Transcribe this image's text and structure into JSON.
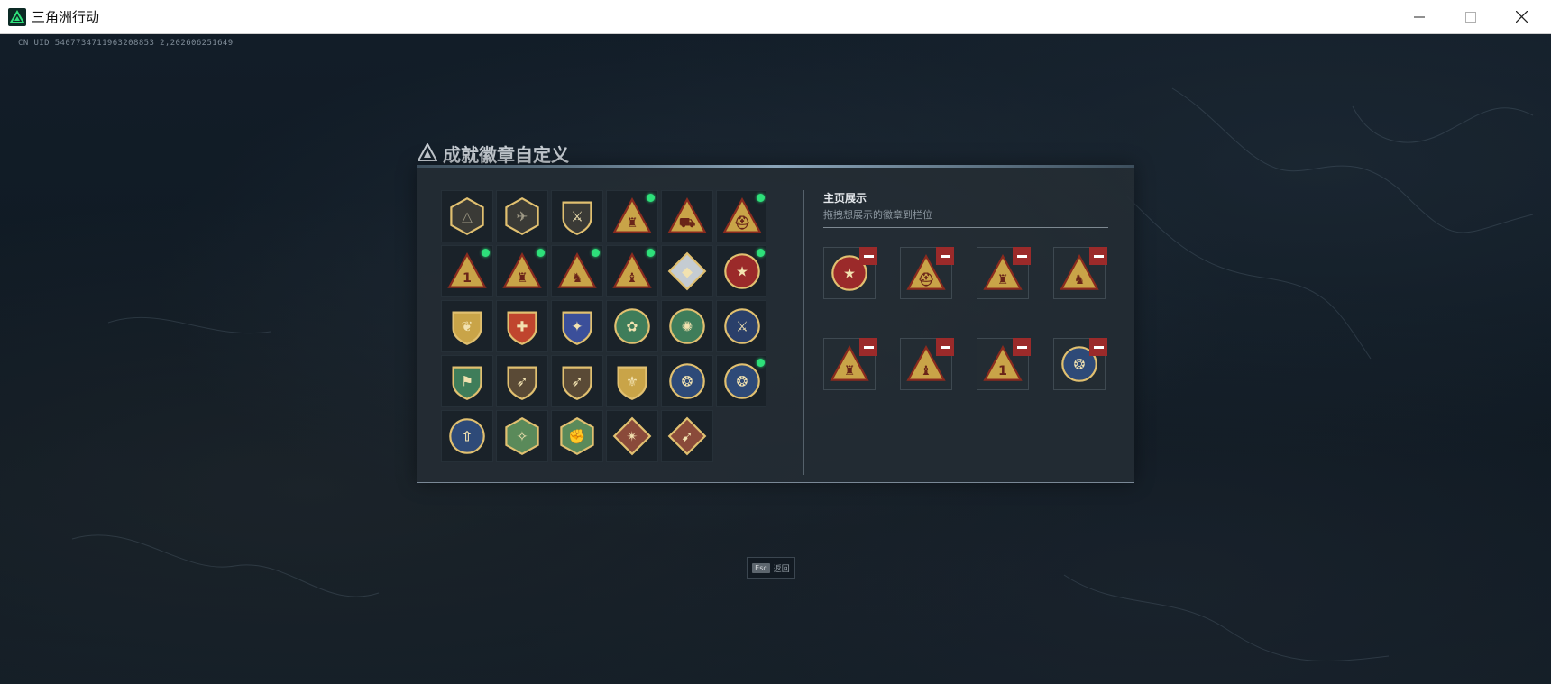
{
  "window": {
    "title": "三角洲行动",
    "controls": {
      "minimize": "minimize-icon",
      "maximize": "maximize-icon",
      "close": "close-icon"
    }
  },
  "uid_text": "CN UID 5407734711963208853 2,202606251649",
  "panel": {
    "title": "成就徽章自定义",
    "showcase_title": "主页展示",
    "showcase_subtitle": "拖拽想展示的徽章到栏位"
  },
  "badges": [
    {
      "shape": "hex",
      "fill": "#3a3a36",
      "emblem": "delta",
      "dot": false
    },
    {
      "shape": "hex",
      "fill": "#3a3a36",
      "emblem": "helicopter",
      "dot": false
    },
    {
      "shape": "shield",
      "fill": "#3a3a36",
      "emblem": "wing",
      "dot": false
    },
    {
      "shape": "triangle",
      "fill": "#c9a448",
      "emblem": "figure",
      "dot": true
    },
    {
      "shape": "triangle",
      "fill": "#c9a448",
      "emblem": "vehicle",
      "dot": false
    },
    {
      "shape": "triangle",
      "fill": "#c9a448",
      "emblem": "helmet",
      "dot": true
    },
    {
      "shape": "triangle",
      "fill": "#c9a448",
      "emblem": "one",
      "dot": true
    },
    {
      "shape": "triangle",
      "fill": "#c9a448",
      "emblem": "figure",
      "dot": true
    },
    {
      "shape": "triangle",
      "fill": "#c9a448",
      "emblem": "soldier",
      "dot": true
    },
    {
      "shape": "triangle",
      "fill": "#c9a448",
      "emblem": "soldier2",
      "dot": true
    },
    {
      "shape": "diamond",
      "fill": "#c5ccd2",
      "emblem": "cube",
      "dot": false
    },
    {
      "shape": "round",
      "fill": "#9b2a2a",
      "emblem": "star",
      "dot": true
    },
    {
      "shape": "shield",
      "fill": "#c9a448",
      "emblem": "wreath",
      "dot": false
    },
    {
      "shape": "shield",
      "fill": "#c0452e",
      "emblem": "cross",
      "dot": false
    },
    {
      "shape": "shield",
      "fill": "#3b4f9a",
      "emblem": "eagle",
      "dot": false
    },
    {
      "shape": "round",
      "fill": "#3f7d5a",
      "emblem": "flower",
      "dot": false
    },
    {
      "shape": "round",
      "fill": "#3f7d5a",
      "emblem": "sun",
      "dot": false
    },
    {
      "shape": "round",
      "fill": "#2a3f6a",
      "emblem": "swords",
      "dot": false
    },
    {
      "shape": "shield",
      "fill": "#3f7d5a",
      "emblem": "wolf",
      "dot": false
    },
    {
      "shape": "shield",
      "fill": "#5a4a36",
      "emblem": "rifle",
      "dot": false
    },
    {
      "shape": "shield",
      "fill": "#5a4a36",
      "emblem": "rifle",
      "dot": false
    },
    {
      "shape": "shield",
      "fill": "#c9a448",
      "emblem": "crest",
      "dot": false
    },
    {
      "shape": "round",
      "fill": "#2e4a78",
      "emblem": "dragon",
      "dot": false
    },
    {
      "shape": "round",
      "fill": "#2e4a78",
      "emblem": "dragon",
      "dot": true
    },
    {
      "shape": "round",
      "fill": "#2e4a78",
      "emblem": "arrow",
      "dot": false
    },
    {
      "shape": "hex",
      "fill": "#5a8a5a",
      "emblem": "bird",
      "dot": false
    },
    {
      "shape": "hex",
      "fill": "#5a8a5a",
      "emblem": "fist",
      "dot": false
    },
    {
      "shape": "diamond",
      "fill": "#8a4a3a",
      "emblem": "beast",
      "dot": false
    },
    {
      "shape": "diamond",
      "fill": "#8a4a3a",
      "emblem": "runner",
      "dot": false
    }
  ],
  "slots": [
    {
      "shape": "round",
      "fill": "#9b2a2a",
      "emblem": "star"
    },
    {
      "shape": "triangle",
      "fill": "#c9a448",
      "emblem": "helmet"
    },
    {
      "shape": "triangle",
      "fill": "#c9a448",
      "emblem": "figure"
    },
    {
      "shape": "triangle",
      "fill": "#c9a448",
      "emblem": "soldier"
    },
    {
      "shape": "triangle",
      "fill": "#c9a448",
      "emblem": "figure"
    },
    {
      "shape": "triangle",
      "fill": "#c9a448",
      "emblem": "soldier2"
    },
    {
      "shape": "triangle",
      "fill": "#c9a448",
      "emblem": "one"
    },
    {
      "shape": "round",
      "fill": "#2e4a78",
      "emblem": "dragon"
    }
  ],
  "esc": {
    "key": "Esc",
    "label": "返回"
  },
  "colors": {
    "accent_green": "#2ee07a",
    "remove_red": "#9b2a2a",
    "gold": "#c9a448"
  }
}
